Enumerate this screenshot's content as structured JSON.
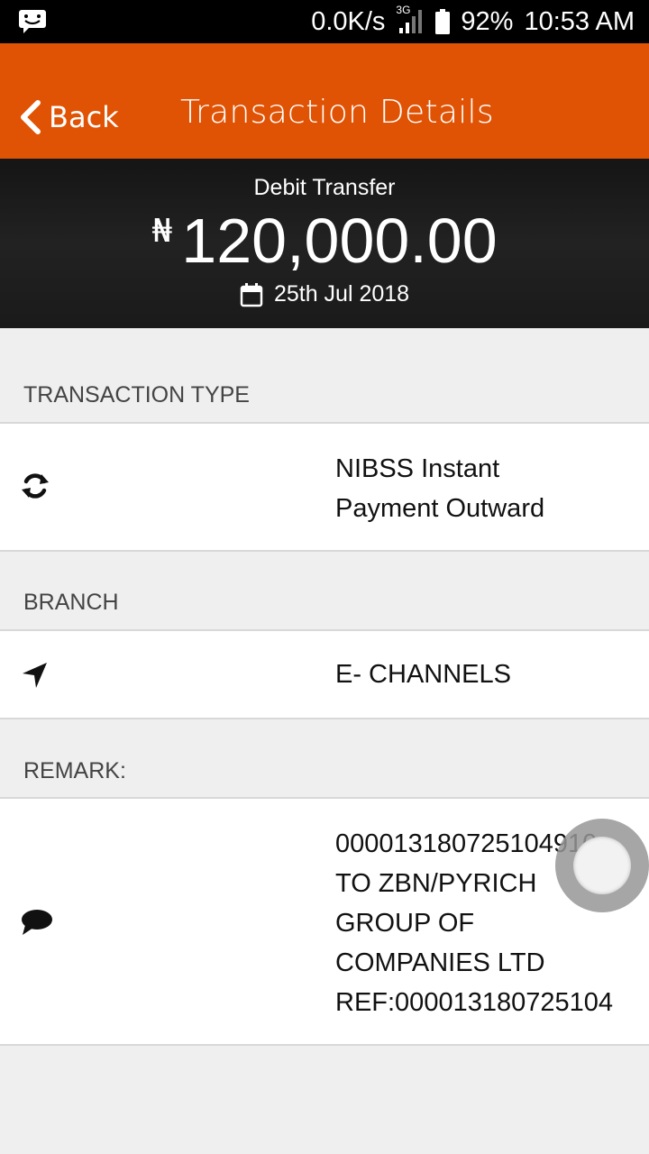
{
  "status_bar": {
    "net_speed": "0.0K/s",
    "network_type": "3G",
    "battery": "92%",
    "time": "10:53 AM"
  },
  "app_bar": {
    "back_label": "Back",
    "title": "Transaction Details"
  },
  "summary": {
    "kind": "Debit Transfer",
    "currency_symbol": "₦",
    "amount": "120,000.00",
    "date": "25th Jul 2018"
  },
  "sections": {
    "type": {
      "label": "TRANSACTION TYPE",
      "value": "NIBSS Instant\nPayment Outward",
      "icon": "refresh-icon"
    },
    "branch": {
      "label": "BRANCH",
      "value": "E- CHANNELS",
      "icon": "location-arrow-icon"
    },
    "remark": {
      "label": "REMARK:",
      "value": "000013180725104910\nTO ZBN/PYRICH\nGROUP OF\nCOMPANIES LTD\nREF:000013180725104",
      "icon": "comment-icon"
    }
  },
  "colors": {
    "accent": "#e05204",
    "header_bg": "#1a1a1a",
    "page_bg": "#efefef"
  }
}
